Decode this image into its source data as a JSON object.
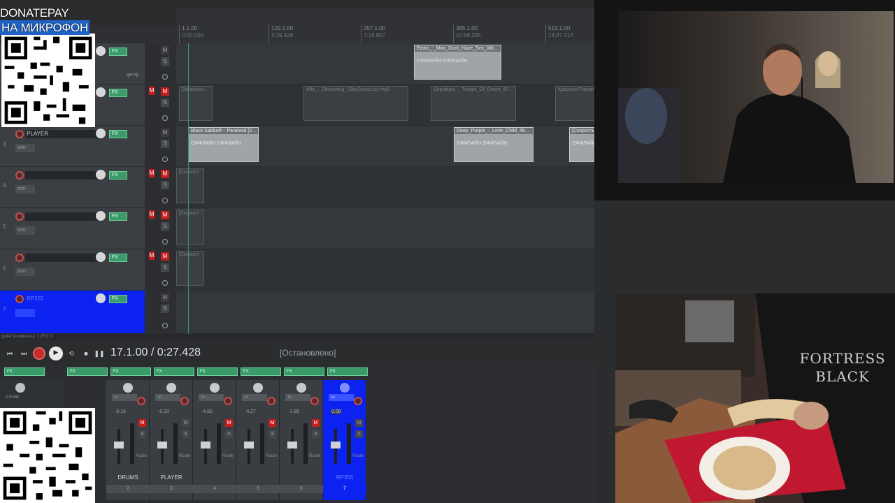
{
  "overlay": {
    "line1": "DONATEPAY",
    "line2": "НА МИКРОФОН"
  },
  "ruler": {
    "ticks": [
      {
        "bar": "1.1.00",
        "time": "0:00.000"
      },
      {
        "bar": "129.1.00",
        "time": "3:39.428"
      },
      {
        "bar": "257.1.00",
        "time": "7:18.857"
      },
      {
        "bar": "385.1.00",
        "time": "10:58.285"
      },
      {
        "bar": "513.1.00",
        "time": "14:37.714"
      }
    ]
  },
  "tracks": [
    {
      "num": "",
      "name": "",
      "fx": "FX",
      "label": "центр"
    },
    {
      "num": "",
      "name": "",
      "fx": "FX"
    },
    {
      "num": "3",
      "name": "PLAYER",
      "fx": "FX",
      "trim": "trim"
    },
    {
      "num": "4",
      "name": "",
      "fx": "FX",
      "trim": "trim"
    },
    {
      "num": "5",
      "name": "",
      "fx": "FX",
      "trim": "trim"
    },
    {
      "num": "6",
      "name": "",
      "fx": "FX",
      "trim": "trim"
    },
    {
      "num": "7",
      "name": "RP355",
      "fx": "FX",
      "trim": "trim"
    }
  ],
  "mute_col": {
    "m": "M",
    "s": "S"
  },
  "clips": {
    "lane1": [
      {
        "name": "Erotic_-_Max_Dont_Have_Sex_Wit...",
        "offline": "ОФФЛАЙН   ОФФЛАЙН"
      }
    ],
    "lane2": [
      {
        "name": "Zdravstvu..."
      },
      {
        "name": "Alfa_-_Zdravstvuj_(SkySound.cc).mp3"
      },
      {
        "name": "Sepultura_-_Troops_Of_Doom_47..."
      },
      {
        "name": "Красная Плесен"
      }
    ],
    "lane3": [
      {
        "name": "Black Sabbath - Paranoid [2...",
        "offline": "ОФФЛАЙН   ОФФЛАЙН"
      },
      {
        "name": "Deep_Purple_-_Love_Child_48...",
        "offline": "ОФФЛАЙН   ОФФЛАЙН"
      },
      {
        "name": "[Скорость",
        "offline": "ОФФЛАЙН"
      }
    ],
    "lane4": [
      {
        "name": "[Скорост"
      }
    ],
    "lane5": [
      {
        "name": "[Скорост"
      }
    ],
    "lane6": [
      {
        "name": "[Скорост"
      }
    ]
  },
  "statusbar": "guitar [элементы]: 1 [FX]: 0",
  "transport": {
    "time": "17.1.00 / 0:27.428",
    "state": "[Остановлено]"
  },
  "mixer": {
    "master_db": "0.00dB",
    "strips": [
      {
        "name": "DRUMS",
        "idx": "2",
        "db": "-0.19",
        "sel": false
      },
      {
        "name": "PLAYER",
        "idx": "3",
        "db": "-0.23",
        "sel": false
      },
      {
        "name": "",
        "idx": "4",
        "db": "-4.82",
        "sel": false
      },
      {
        "name": "",
        "idx": "5",
        "db": "-4.27",
        "sel": false
      },
      {
        "name": "",
        "idx": "6",
        "db": "-1.89",
        "sel": false
      },
      {
        "name": "RP355",
        "idx": "7",
        "db": "0.00",
        "sel": true
      }
    ],
    "in_label": "in",
    "route_label": "Route",
    "fx_label": "FX",
    "m": "M",
    "s": "S"
  },
  "video_shirt_text": "FORTRESS BLACK"
}
